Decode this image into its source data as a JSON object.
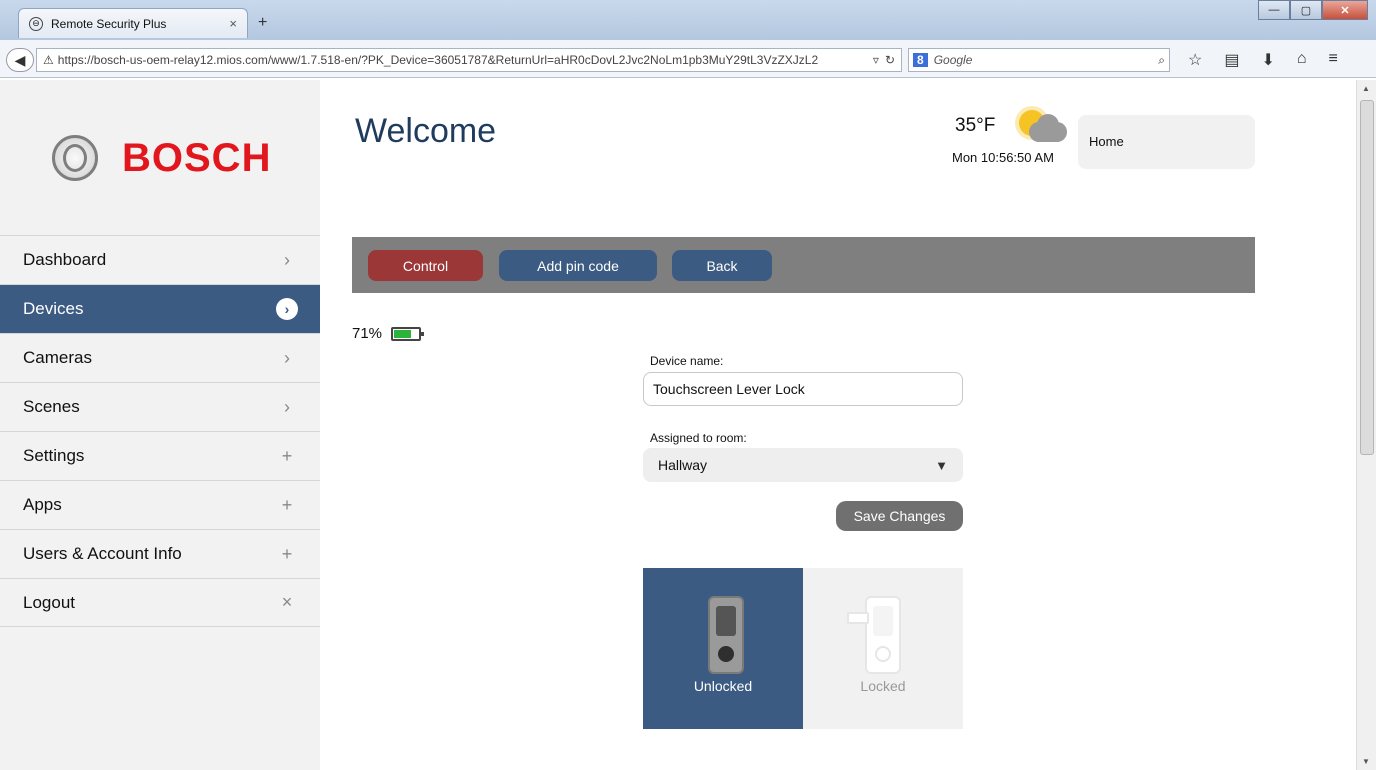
{
  "browser": {
    "tab_title": "Remote Security Plus",
    "tab_close": "×",
    "new_tab": "+",
    "url": "https://bosch-us-oem-relay12.mios.com/www/1.7.518-en/?PK_Device=36051787&ReturnUrl=aHR0cDovL2Jvc2NoLm1pb3MuY29tL3VzZXJzL2",
    "search_placeholder": "Google",
    "search_engine": "8",
    "minimize": "—",
    "restore": "▢",
    "close": "✕"
  },
  "sidebar": {
    "brand": "BOSCH",
    "brand_color": "#e2161d",
    "items": [
      {
        "label": "Dashboard",
        "indicator": "›"
      },
      {
        "label": "Devices",
        "indicator": "›"
      },
      {
        "label": "Cameras",
        "indicator": "›"
      },
      {
        "label": "Scenes",
        "indicator": "›"
      },
      {
        "label": "Settings",
        "indicator": "+"
      },
      {
        "label": "Apps",
        "indicator": "+"
      },
      {
        "label": "Users & Account Info",
        "indicator": "+"
      },
      {
        "label": "Logout",
        "indicator": "×"
      }
    ],
    "active_index": 1,
    "active_color": "#3b5b82"
  },
  "header": {
    "title": "Welcome",
    "temperature": "35°F",
    "clock": "Mon 10:56:50 AM",
    "location": "Home",
    "weather_icon": "partly-cloudy-icon"
  },
  "toolbar": {
    "control": "Control",
    "add_pin": "Add pin code",
    "back": "Back"
  },
  "device": {
    "battery_pct_text": "71%",
    "battery_level": 0.71,
    "name_label": "Device name:",
    "name_value": "Touchscreen Lever Lock",
    "room_label": "Assigned to room:",
    "room_value": "Hallway",
    "save_label": "Save Changes",
    "states": {
      "unlocked": "Unlocked",
      "locked": "Locked"
    },
    "current_state": "unlocked"
  }
}
